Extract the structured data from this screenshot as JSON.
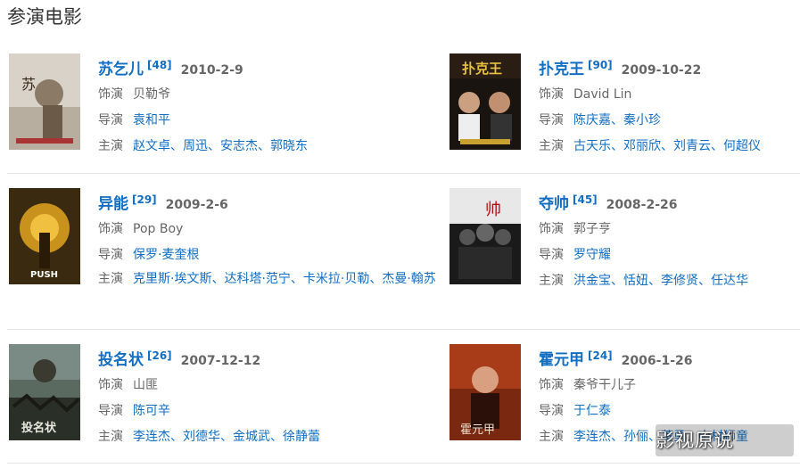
{
  "section": {
    "title": "参演电影"
  },
  "labels": {
    "role": "饰演",
    "director": "导演",
    "starring": "主演"
  },
  "movies": [
    {
      "title": "苏乞儿",
      "ref": "[48]",
      "date": "2010-2-9",
      "role": "贝勒爷",
      "directors": [
        "袁和平"
      ],
      "stars": [
        "赵文卓",
        "周迅",
        "安志杰",
        "郭晓东"
      ]
    },
    {
      "title": "扑克王",
      "ref": "[90]",
      "date": "2009-10-22",
      "role": "David Lin",
      "directors": [
        "陈庆嘉",
        "秦小珍"
      ],
      "stars": [
        "古天乐",
        "邓丽欣",
        "刘青云",
        "何超仪"
      ]
    },
    {
      "title": "异能",
      "ref": "[29]",
      "date": "2009-2-6",
      "role": "Pop Boy",
      "directors": [
        "保罗·麦奎根"
      ],
      "stars": [
        "克里斯·埃文斯",
        "达科塔·范宁",
        "卡米拉·贝勒",
        "杰曼·翰苏"
      ]
    },
    {
      "title": "夺帅",
      "ref": "[45]",
      "date": "2008-2-26",
      "role": "郭子亨",
      "directors": [
        "罗守耀"
      ],
      "stars": [
        "洪金宝",
        "恬妞",
        "李修贤",
        "任达华"
      ]
    },
    {
      "title": "投名状",
      "ref": "[26]",
      "date": "2007-12-12",
      "role": "山匪",
      "directors": [
        "陈可辛"
      ],
      "stars": [
        "李连杰",
        "刘德华",
        "金城武",
        "徐静蕾"
      ]
    },
    {
      "title": "霍元甲",
      "ref": "[24]",
      "date": "2006-1-26",
      "role": "秦爷干儿子",
      "directors": [
        "于仁泰"
      ],
      "stars": [
        "李连杰",
        "孙俪",
        "董勇",
        "中村狮童"
      ]
    }
  ],
  "watermark": "影视原说",
  "colors": {
    "link": "#136ec2",
    "label": "#666666",
    "divider": "#e6e6e6"
  }
}
